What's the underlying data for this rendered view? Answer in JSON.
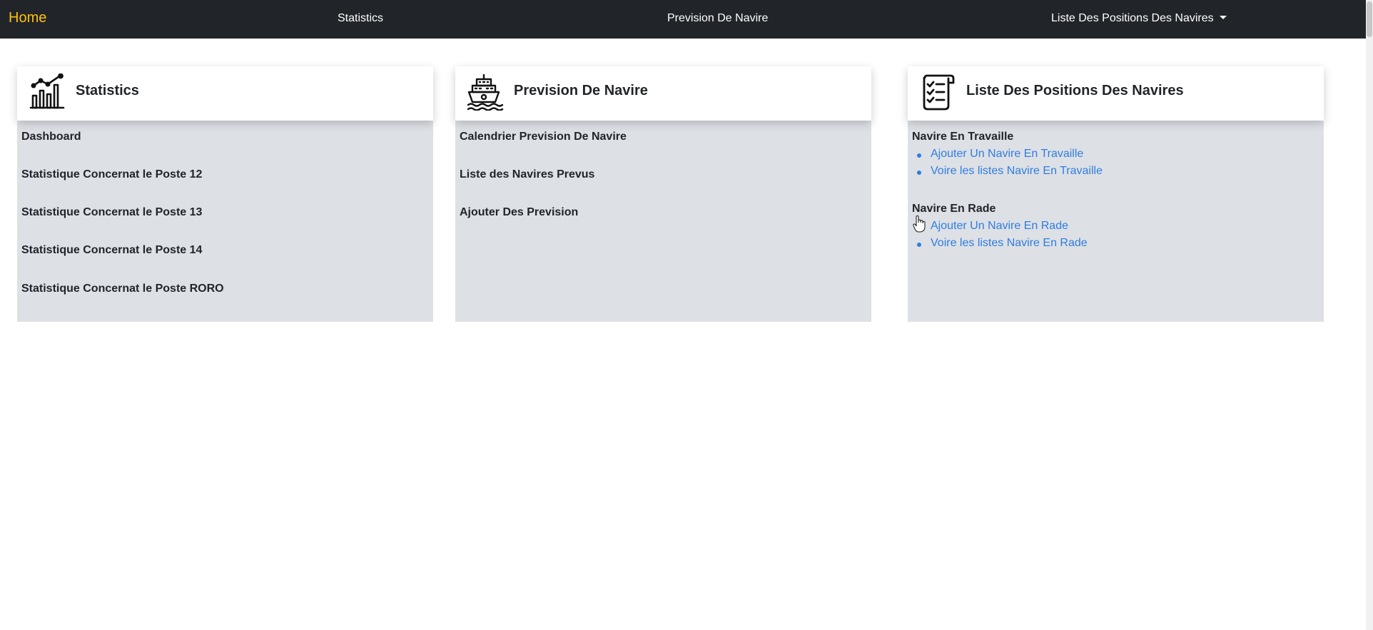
{
  "navbar": {
    "brand": "Home",
    "links": [
      "Statistics",
      "Prevision De Navire"
    ],
    "dropdown": "Liste Des Positions Des Navires"
  },
  "cards": [
    {
      "title": "Statistics",
      "icon": "chart-growth-icon",
      "links": [
        "Dashboard",
        "Statistique Concernat le Poste 12",
        "Statistique Concernat le Poste 13",
        "Statistique Concernat le Poste 14",
        "Statistique Concernat le Poste RORO"
      ]
    },
    {
      "title": "Prevision De Navire",
      "icon": "ship-icon",
      "links": [
        "Calendrier Prevision De Navire",
        "Liste des Navires Prevus",
        "Ajouter Des Prevision"
      ]
    },
    {
      "title": "Liste Des Positions Des Navires",
      "icon": "checklist-icon",
      "groups": [
        {
          "title": "Navire En Travaille",
          "items": [
            "Ajouter Un Navire En Travaille",
            "Voire les listes Navire En Travaille"
          ]
        },
        {
          "title": "Navire En Rade",
          "items": [
            "Ajouter Un Navire En Rade",
            "Voire les listes Navire En Rade"
          ]
        }
      ]
    }
  ],
  "colors": {
    "navbar_bg": "#212529",
    "brand": "#ffc107",
    "card_body_bg": "#dde0e5",
    "link": "#2f7de1"
  }
}
